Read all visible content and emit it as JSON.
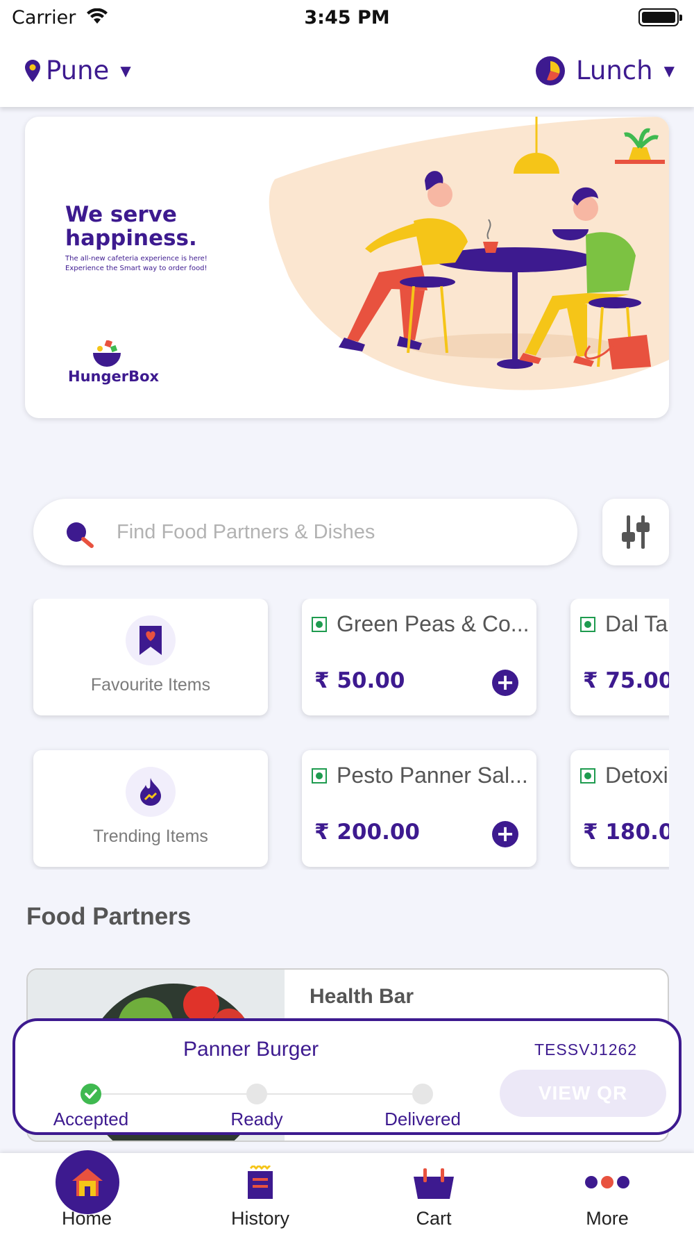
{
  "status_bar": {
    "carrier": "Carrier",
    "time": "3:45 PM"
  },
  "header": {
    "location": "Pune",
    "meal": "Lunch"
  },
  "banner": {
    "title": "We serve happiness.",
    "subtitle": "The all-new cafeteria experience is here! Experience the Smart way to order food!",
    "brand": "HungerBox"
  },
  "search": {
    "placeholder": "Find Food Partners & Dishes"
  },
  "categories": [
    {
      "label": "Favourite Items",
      "icon": "bookmark-heart-icon"
    },
    {
      "label": "Trending Items",
      "icon": "flame-trend-icon"
    }
  ],
  "dishes": [
    {
      "name": "Green Peas & Co...",
      "price": "₹ 50.00"
    },
    {
      "name": "Dal Ta",
      "price": "₹ 75.00"
    },
    {
      "name": "Pesto Panner Sal...",
      "price": "₹ 200.00"
    },
    {
      "name": "Detoxi",
      "price": "₹ 180.00"
    }
  ],
  "food_partners": {
    "title": "Food Partners",
    "items": [
      {
        "name": "Health Bar"
      }
    ]
  },
  "order": {
    "item": "Panner Burger",
    "id": "TESSVJ1262",
    "steps": [
      "Accepted",
      "Ready",
      "Delivered"
    ],
    "completed_steps": 1,
    "button": "VIEW QR"
  },
  "tabs": [
    {
      "label": "Home",
      "icon": "home-icon",
      "active": true
    },
    {
      "label": "History",
      "icon": "history-icon"
    },
    {
      "label": "Cart",
      "icon": "cart-icon"
    },
    {
      "label": "More",
      "icon": "more-dots-icon"
    }
  ],
  "colors": {
    "primary": "#3d1a8f",
    "accent": "#f5c518",
    "veg": "#1e9b4f",
    "success": "#3fb950",
    "background": "#f3f4fb"
  }
}
